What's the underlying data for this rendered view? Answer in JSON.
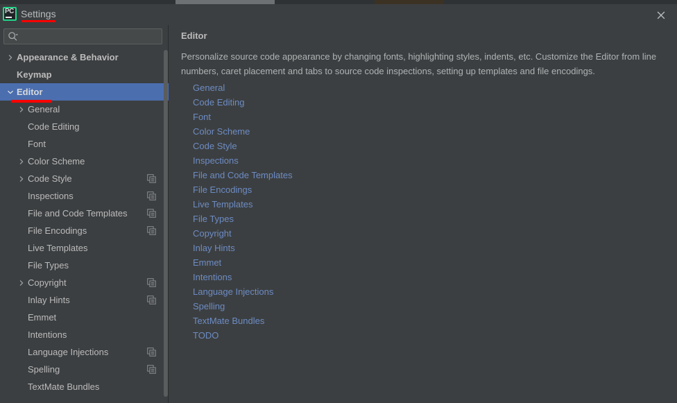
{
  "window": {
    "title": "Settings",
    "logo_icon": "pycharm-logo-icon",
    "logo_text": "PC",
    "close_icon": "close-icon"
  },
  "search": {
    "icon": "search-icon",
    "value": "",
    "placeholder": ""
  },
  "sidebar": {
    "scrollbar": "sidebar-scrollbar",
    "items": [
      {
        "label": "Appearance & Behavior",
        "level": 0,
        "bold": true,
        "twisty": "collapsed",
        "badge": false,
        "selected": false
      },
      {
        "label": "Keymap",
        "level": 0,
        "bold": true,
        "twisty": "none",
        "badge": false,
        "selected": false
      },
      {
        "label": "Editor",
        "level": 0,
        "bold": true,
        "twisty": "expanded",
        "badge": false,
        "selected": true
      },
      {
        "label": "General",
        "level": 1,
        "bold": false,
        "twisty": "collapsed",
        "badge": false,
        "selected": false
      },
      {
        "label": "Code Editing",
        "level": 1,
        "bold": false,
        "twisty": "none",
        "badge": false,
        "selected": false
      },
      {
        "label": "Font",
        "level": 1,
        "bold": false,
        "twisty": "none",
        "badge": false,
        "selected": false
      },
      {
        "label": "Color Scheme",
        "level": 1,
        "bold": false,
        "twisty": "collapsed",
        "badge": false,
        "selected": false
      },
      {
        "label": "Code Style",
        "level": 1,
        "bold": false,
        "twisty": "collapsed",
        "badge": true,
        "selected": false
      },
      {
        "label": "Inspections",
        "level": 1,
        "bold": false,
        "twisty": "none",
        "badge": true,
        "selected": false
      },
      {
        "label": "File and Code Templates",
        "level": 1,
        "bold": false,
        "twisty": "none",
        "badge": true,
        "selected": false
      },
      {
        "label": "File Encodings",
        "level": 1,
        "bold": false,
        "twisty": "none",
        "badge": true,
        "selected": false
      },
      {
        "label": "Live Templates",
        "level": 1,
        "bold": false,
        "twisty": "none",
        "badge": false,
        "selected": false
      },
      {
        "label": "File Types",
        "level": 1,
        "bold": false,
        "twisty": "none",
        "badge": false,
        "selected": false
      },
      {
        "label": "Copyright",
        "level": 1,
        "bold": false,
        "twisty": "collapsed",
        "badge": true,
        "selected": false
      },
      {
        "label": "Inlay Hints",
        "level": 1,
        "bold": false,
        "twisty": "none",
        "badge": true,
        "selected": false
      },
      {
        "label": "Emmet",
        "level": 1,
        "bold": false,
        "twisty": "none",
        "badge": false,
        "selected": false
      },
      {
        "label": "Intentions",
        "level": 1,
        "bold": false,
        "twisty": "none",
        "badge": false,
        "selected": false
      },
      {
        "label": "Language Injections",
        "level": 1,
        "bold": false,
        "twisty": "none",
        "badge": true,
        "selected": false
      },
      {
        "label": "Spelling",
        "level": 1,
        "bold": false,
        "twisty": "none",
        "badge": true,
        "selected": false
      },
      {
        "label": "TextMate Bundles",
        "level": 1,
        "bold": false,
        "twisty": "none",
        "badge": false,
        "selected": false
      }
    ]
  },
  "main": {
    "title": "Editor",
    "description": "Personalize source code appearance by changing fonts, highlighting styles, indents, etc. Customize the Editor from line numbers, caret placement and tabs to source code inspections, setting up templates and file encodings.",
    "links": [
      "General",
      "Code Editing",
      "Font",
      "Color Scheme",
      "Code Style",
      "Inspections",
      "File and Code Templates",
      "File Encodings",
      "Live Templates",
      "File Types",
      "Copyright",
      "Inlay Hints",
      "Emmet",
      "Intentions",
      "Language Injections",
      "Spelling",
      "TextMate Bundles",
      "TODO"
    ]
  },
  "annotations": [
    {
      "name": "underline-settings-title",
      "color": "#fe0000"
    },
    {
      "name": "underline-editor-item",
      "color": "#fe0000"
    }
  ],
  "colors": {
    "background": "#3c3f41",
    "selection": "#4b6eaf",
    "link": "#6d8cc4",
    "text": "#bbbbbb",
    "accent_logo": "#21d789",
    "annotation": "#fe0000"
  }
}
